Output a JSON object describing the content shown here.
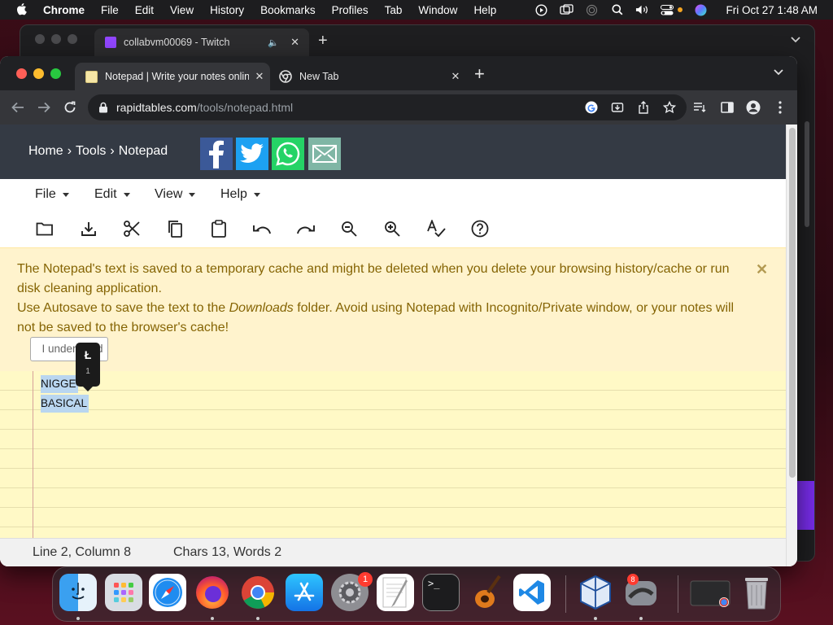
{
  "menubar": {
    "app_name": "Chrome",
    "items": [
      "File",
      "Edit",
      "View",
      "History",
      "Bookmarks",
      "Profiles",
      "Tab",
      "Window",
      "Help"
    ],
    "clock": "Fri Oct 27  1:48 AM"
  },
  "background_window": {
    "tab_title": "collabvm00069 - Twitch",
    "tab_close": "✕",
    "new_tab": "+"
  },
  "browser": {
    "tabs": [
      {
        "title": "Notepad | Write your notes online",
        "close": "✕"
      },
      {
        "title": "New Tab",
        "close": "✕"
      }
    ],
    "new_tab": "+",
    "url_domain": "rapidtables.com",
    "url_path": "/tools/notepad.html"
  },
  "site": {
    "breadcrumb": [
      "Home",
      "Tools",
      "Notepad"
    ],
    "breadcrumb_sep": "›",
    "social": [
      "facebook",
      "twitter",
      "whatsapp",
      "email"
    ]
  },
  "notepad": {
    "menus": [
      "File",
      "Edit",
      "View",
      "Help"
    ],
    "tools": [
      "open",
      "save",
      "cut",
      "copy",
      "paste",
      "undo",
      "redo",
      "zoom-out",
      "zoom-in",
      "spellcheck",
      "help"
    ],
    "notice": {
      "line1": "The Notepad's text is saved to a temporary cache and might be deleted when you delete your browsing history/cache or run disk cleaning application.",
      "line2_a": "Use Autosave to save the text to the ",
      "line2_em": "Downloads",
      "line2_b": " folder. Avoid using Notepad with Incognito/Private window, or your notes will not be saved to the browser's cache!",
      "close": "✕",
      "button": "I understand"
    },
    "text_lines": [
      "NIGGE",
      "BASICAL"
    ],
    "tooltip": {
      "glyph": "Ł",
      "index": "1"
    },
    "status": {
      "position": "Line 2, Column 8",
      "counts": "Chars 13, Words 2"
    }
  },
  "dock": {
    "apps": [
      "finder",
      "launchpad",
      "safari",
      "firefox",
      "chrome",
      "app-store",
      "system-settings",
      "textedit",
      "terminal",
      "garageband",
      "vscode",
      "virtualbox",
      "utm",
      "minimized-window",
      "trash"
    ],
    "settings_badge": "1",
    "utm_badge": "8",
    "terminal_prompt": ">_"
  },
  "colors": {
    "site_header": "#343a44",
    "notice_bg": "#fff3cd",
    "notice_text": "#856404",
    "paper": "#fff9c6",
    "selection": "#b9d6f0",
    "facebook": "#3b5998",
    "twitter": "#1da1f2",
    "whatsapp": "#25d366",
    "email": "#7fb6a5"
  }
}
